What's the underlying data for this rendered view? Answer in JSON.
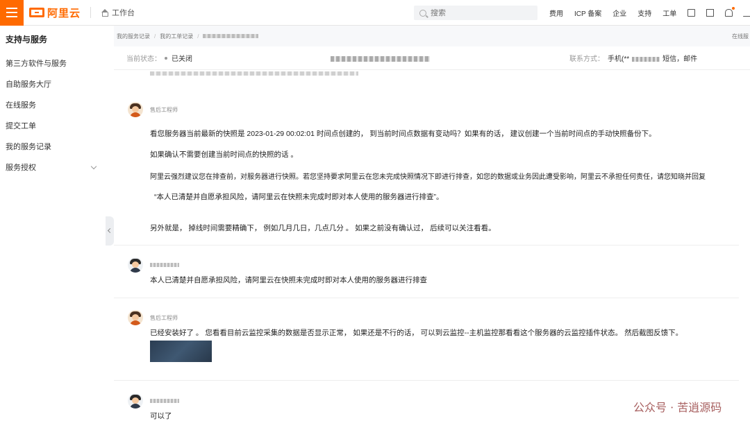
{
  "topbar": {
    "logo": "阿里云",
    "workbench": "工作台",
    "search_placeholder": "搜索",
    "nav": [
      "费用",
      "ICP 备案",
      "企业",
      "支持",
      "工单"
    ]
  },
  "sidebar": {
    "title": "支持与服务",
    "items": [
      "第三方软件与服务",
      "自助服务大厅",
      "在线服务",
      "提交工单",
      "我的服务记录",
      "服务授权"
    ]
  },
  "breadcrumb": {
    "items": [
      "我的服务记录",
      "我的工单记录"
    ],
    "right": "在线服"
  },
  "status": {
    "label": "当前状态：",
    "value": "已关闭",
    "contact_label": "联系方式：",
    "contact_phone": "手机(**",
    "contact_tail": "短信，邮件"
  },
  "messages": [
    {
      "sender": "售后工程师",
      "lines": [
        "看您服务器当前最新的快照是 2023-01-29 00:02:01  时间点创建的， 到当前时间点数据有变动吗？如果有的话， 建议创建一个当前时间点的手动快照备份下。",
        "如果确认不需要创建当前时间点的快照的话 。",
        "阿里云强烈建议您在排查前，对服务器进行快照。若您坚持要求阿里云在您未完成快照情况下即进行排查，如您的数据或业务因此遭受影响，阿里云不承担任何责任，请您知晓并回复",
        "“本人已清楚并自愿承担风险，请阿里云在快照未完成时即对本人使用的服务器进行排查”。",
        "另外就是， 掉线时间需要精确下， 例如几月几日，几点几分 。 如果之前没有确认过， 后续可以关注看看。"
      ]
    },
    {
      "sender": "",
      "lines": [
        "本人已清楚并自愿承担风险，请阿里云在快照未完成时即对本人使用的服务器进行排查"
      ]
    },
    {
      "sender": "售后工程师",
      "lines": [
        " 已经安装好了 。 您看看目前云监控采集的数据是否显示正常， 如果还是不行的话， 可以到云监控--主机监控那看看这个服务器的云监控插件状态。 然后截图反馈下。"
      ]
    },
    {
      "sender": "",
      "lines": [
        "可以了"
      ]
    }
  ],
  "watermark": "公众号 · 苦逍源码"
}
